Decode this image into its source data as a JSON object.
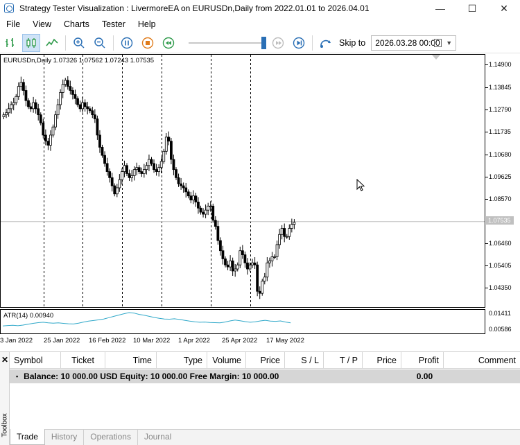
{
  "window": {
    "title": "Strategy Tester Visualization : LivermoreEA on EURUSDn,Daily from 2022.01.01 to 2026.04.01",
    "minimize": "—",
    "maximize": "☐",
    "close": "✕"
  },
  "menu": [
    "File",
    "View",
    "Charts",
    "Tester",
    "Help"
  ],
  "toolbar": {
    "skip_label": "Skip to",
    "skip_date": "2026.03.28 00:00",
    "icons": [
      "bar-chart-icon",
      "candlestick-icon",
      "line-chart-icon",
      "zoom-in-icon",
      "zoom-out-icon",
      "pause-icon",
      "stop-icon",
      "rewind-icon",
      "step-forward-icon",
      "fast-forward-icon",
      "skip-to-icon"
    ],
    "accent": "#2a6fb5",
    "slider_value": 1.0
  },
  "chart": {
    "header": "EURUSDn,Daily  1.07326 1.07562 1.07243 1.07535",
    "current_price": "1.07535",
    "price_labels": [
      "1.14900",
      "1.13845",
      "1.12790",
      "1.11735",
      "1.10680",
      "1.09625",
      "1.08570",
      "1.07535",
      "1.06460",
      "1.05405",
      "1.04350"
    ],
    "atr_label": "ATR(14) 0.00940",
    "atr_labels": [
      "0.01411",
      "0.00586"
    ],
    "time_labels": [
      "3 Jan 2022",
      "25 Jan 2022",
      "16 Feb 2022",
      "10 Mar 2022",
      "1 Apr 2022",
      "25 Apr 2022",
      "17 May 2022"
    ]
  },
  "chart_data": {
    "type": "candlestick",
    "symbol": "EURUSDn",
    "timeframe": "Daily",
    "last": {
      "open": 1.07326,
      "high": 1.07562,
      "low": 1.07243,
      "close": 1.07535
    },
    "closes": [
      1.128,
      1.129,
      1.131,
      1.133,
      1.134,
      1.137,
      1.142,
      1.144,
      1.14,
      1.135,
      1.132,
      1.131,
      1.134,
      1.131,
      1.128,
      1.124,
      1.118,
      1.115,
      1.113,
      1.118,
      1.122,
      1.128,
      1.133,
      1.139,
      1.143,
      1.145,
      1.142,
      1.14,
      1.138,
      1.136,
      1.133,
      1.131,
      1.134,
      1.132,
      1.131,
      1.13,
      1.128,
      1.126,
      1.118,
      1.112,
      1.108,
      1.104,
      1.1,
      1.097,
      1.093,
      1.089,
      1.092,
      1.096,
      1.1,
      1.103,
      1.099,
      1.097,
      1.098,
      1.101,
      1.102,
      1.1,
      1.099,
      1.101,
      1.103,
      1.106,
      1.104,
      1.101,
      1.1,
      1.102,
      1.105,
      1.11,
      1.117,
      1.115,
      1.106,
      1.101,
      1.097,
      1.094,
      1.093,
      1.092,
      1.09,
      1.088,
      1.086,
      1.088,
      1.085,
      1.082,
      1.08,
      1.079,
      1.081,
      1.083,
      1.083,
      1.076,
      1.073,
      1.066,
      1.061,
      1.057,
      1.054,
      1.053,
      1.056,
      1.051,
      1.052,
      1.054,
      1.061,
      1.059,
      1.055,
      1.052,
      1.054,
      1.055,
      1.054,
      1.041,
      1.04,
      1.046,
      1.048,
      1.055,
      1.056,
      1.058,
      1.058,
      1.064,
      1.069,
      1.072,
      1.068,
      1.068,
      1.072,
      1.074,
      1.075
    ],
    "atr": [
      0.008,
      0.0082,
      0.0083,
      0.0081,
      0.0084,
      0.0088,
      0.0092,
      0.0095,
      0.0097,
      0.0094,
      0.0093,
      0.0094,
      0.0092,
      0.009,
      0.0089,
      0.0093,
      0.0098,
      0.0102,
      0.0105,
      0.0108,
      0.0112,
      0.0118,
      0.0124,
      0.013,
      0.0136,
      0.0141,
      0.0139,
      0.0133,
      0.0129,
      0.0124,
      0.0119,
      0.0115,
      0.0112,
      0.0111,
      0.0113,
      0.011,
      0.0106,
      0.0102,
      0.0099,
      0.0097,
      0.0098,
      0.0096,
      0.0095,
      0.0094,
      0.0098,
      0.0103,
      0.0107,
      0.0104,
      0.01,
      0.0097,
      0.0099,
      0.0103,
      0.0106,
      0.0102,
      0.0101,
      0.0103,
      0.0098,
      0.0094
    ],
    "ylim": [
      1.038,
      1.1535
    ],
    "atr_ylim": [
      0.00586,
      0.01411
    ],
    "separators_after_candle": [
      16,
      32,
      48,
      64,
      84,
      100
    ],
    "grid": false
  },
  "toolbox": {
    "close": "✕",
    "side_label": "Toolbox",
    "columns": [
      "Symbol",
      "Ticket",
      "Time",
      "Type",
      "Volume",
      "Price",
      "S / L",
      "T / P",
      "Price",
      "Profit",
      "Comment"
    ],
    "balance_text": "Balance: 10 000.00 USD  Equity: 10 000.00  Free Margin: 10 000.00",
    "balance_profit": "0.00",
    "tabs": [
      "Trade",
      "History",
      "Operations",
      "Journal"
    ],
    "active_tab": "Trade"
  }
}
